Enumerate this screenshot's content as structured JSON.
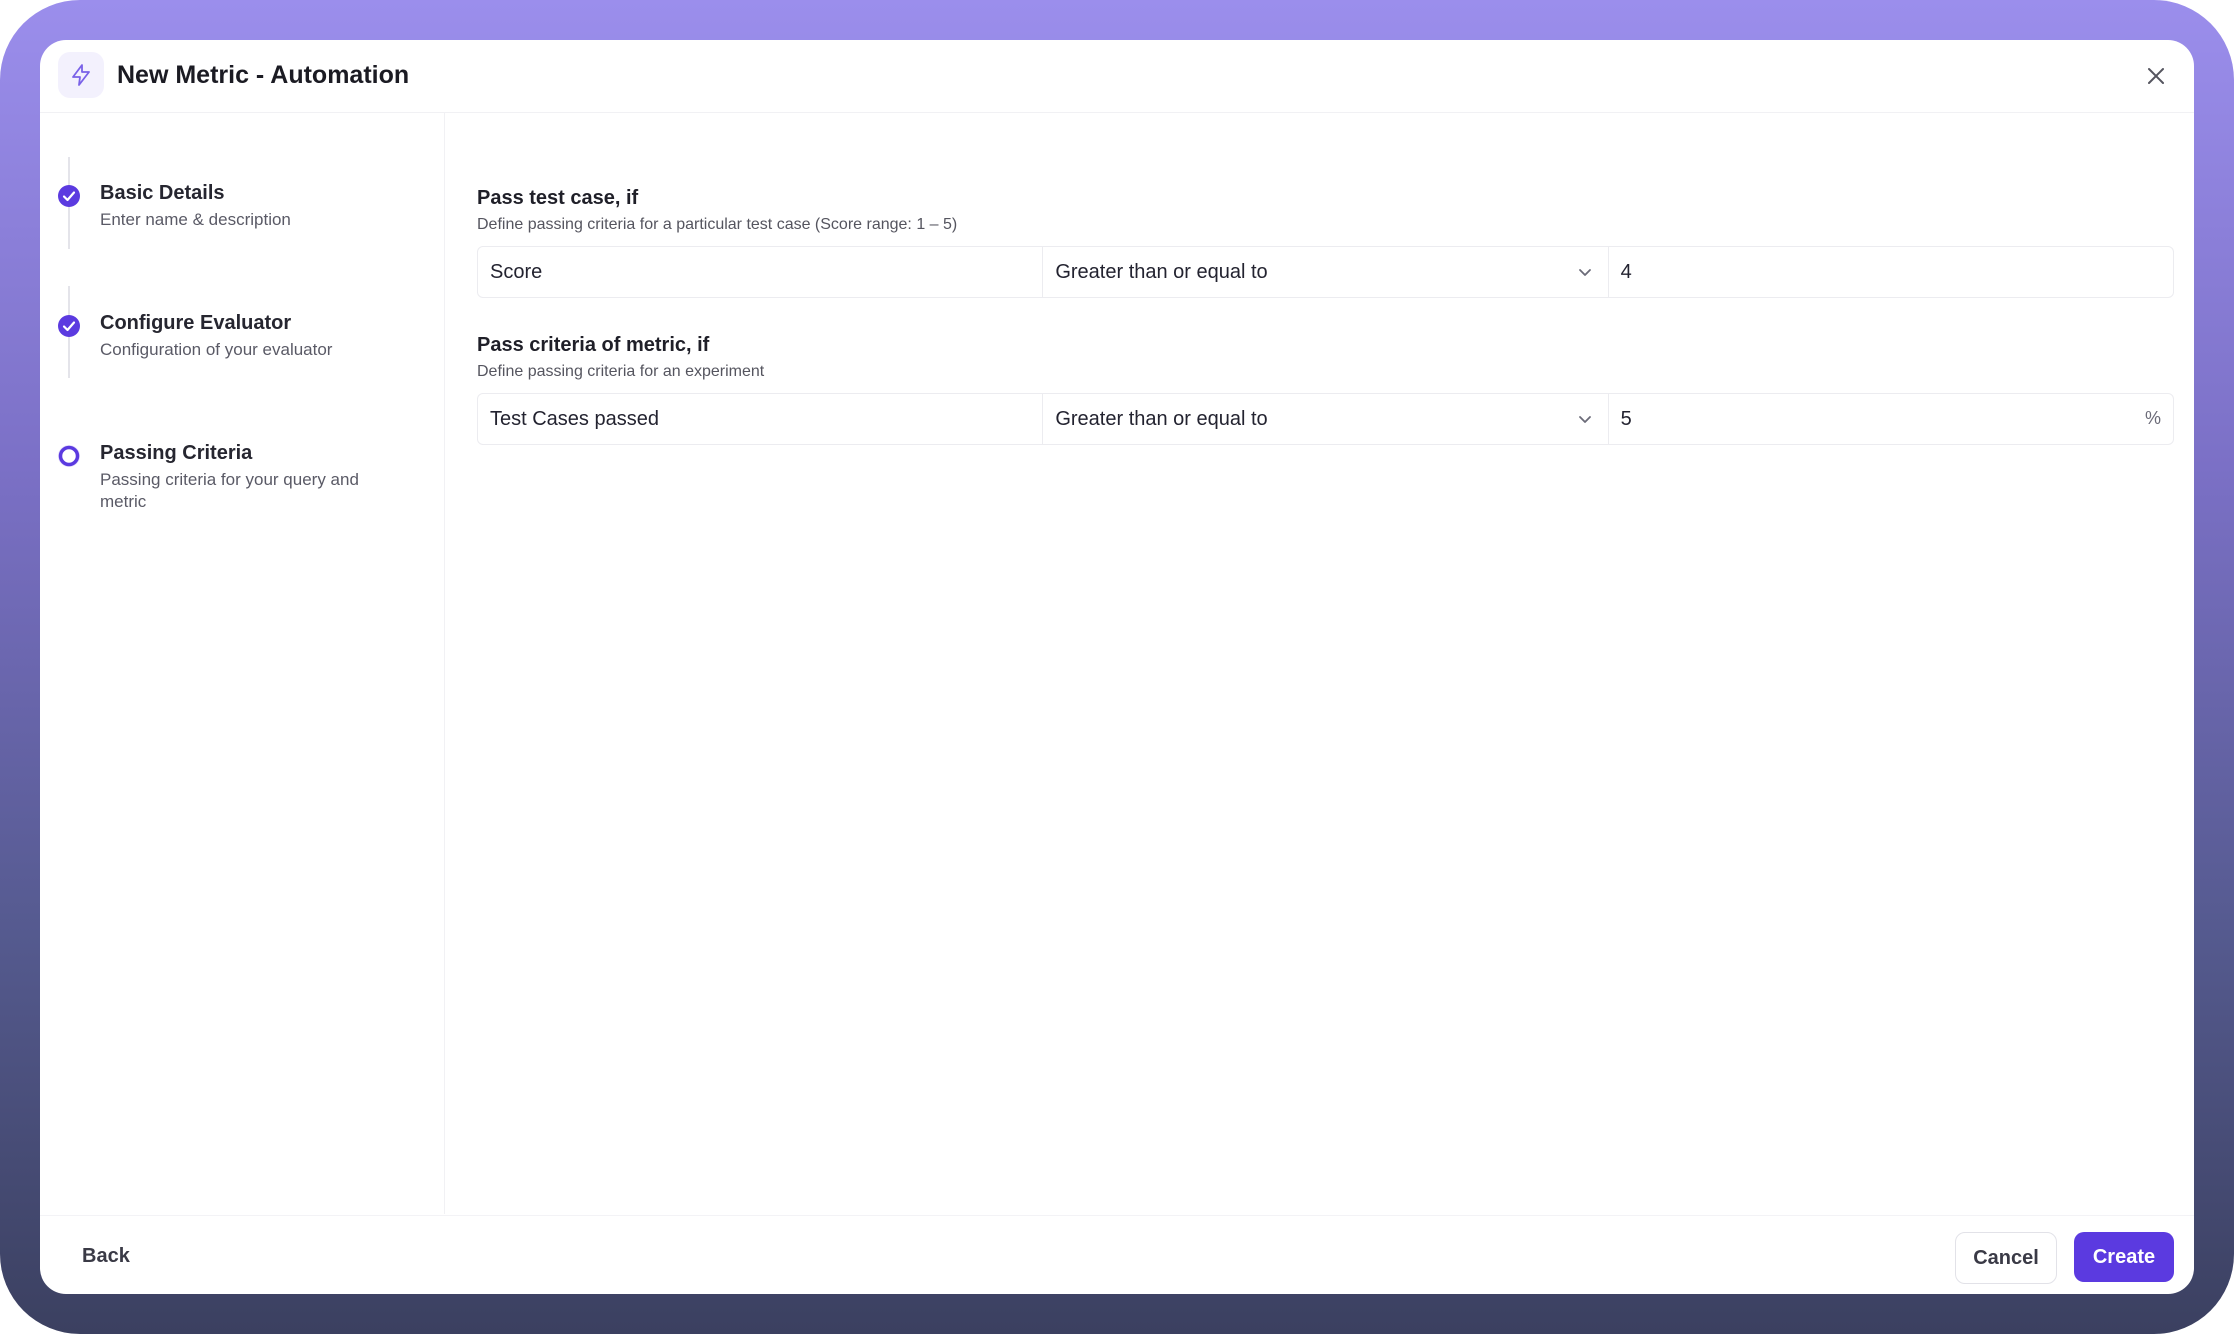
{
  "header": {
    "title": "New Metric - Automation",
    "icon": "lightning-icon"
  },
  "close": {
    "icon": "close-icon"
  },
  "steps": [
    {
      "title": "Basic Details",
      "description": "Enter name & description",
      "state": "completed"
    },
    {
      "title": "Configure Evaluator",
      "description": "Configuration of your evaluator",
      "state": "completed"
    },
    {
      "title": "Passing Criteria",
      "description": "Passing criteria for your query and metric",
      "state": "current"
    }
  ],
  "test_case": {
    "title": "Pass test case, if",
    "description": "Define passing criteria for a particular test case (Score range: 1 – 5)",
    "field": "Score",
    "operator": "Greater than or equal to",
    "value": "4"
  },
  "metric": {
    "title": "Pass criteria of metric, if",
    "description": "Define passing criteria for an experiment",
    "field": "Test Cases passed",
    "operator": "Greater than or equal to",
    "value": "5",
    "unit": "%"
  },
  "footer": {
    "back_label": "Back",
    "cancel_label": "Cancel",
    "create_label": "Create"
  },
  "colors": {
    "accent": "#5b3ae0",
    "frame_top": "#9b8eec",
    "frame_bottom": "#3b4060"
  }
}
